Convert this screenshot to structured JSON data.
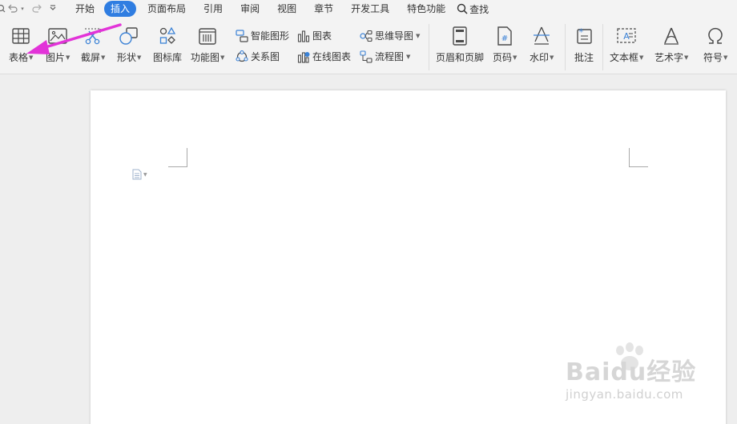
{
  "quick_access": {
    "items": [
      "search-icon",
      "undo-icon",
      "redo-icon",
      "more-icon"
    ]
  },
  "menu": {
    "tabs": [
      {
        "label": "开始",
        "active": false
      },
      {
        "label": "插入",
        "active": true
      },
      {
        "label": "页面布局",
        "active": false
      },
      {
        "label": "引用",
        "active": false
      },
      {
        "label": "审阅",
        "active": false
      },
      {
        "label": "视图",
        "active": false
      },
      {
        "label": "章节",
        "active": false
      },
      {
        "label": "开发工具",
        "active": false
      },
      {
        "label": "特色功能",
        "active": false
      }
    ],
    "search_label": "查找"
  },
  "ribbon": {
    "table": "表格",
    "picture": "图片",
    "screenshot": "截屏",
    "shape": "形状",
    "icon_library": "图标库",
    "function_chart": "功能图",
    "smart_graphic": "智能图形",
    "chart": "图表",
    "relationship_chart": "关系图",
    "online_chart": "在线图表",
    "mind_map": "思维导图",
    "flowchart": "流程图",
    "header_footer": "页眉和页脚",
    "page_number": "页码",
    "watermark": "水印",
    "comment": "批注",
    "text_box": "文本框",
    "word_art": "艺术字",
    "symbol": "符号"
  },
  "colors": {
    "accent": "#2f7de1",
    "arrow": "#e233d8",
    "icon": "#4a4a4a",
    "icon_blue": "#3b82d6"
  },
  "watermark": {
    "main": "Baidu经验",
    "url": "jingyan.baidu.com"
  }
}
